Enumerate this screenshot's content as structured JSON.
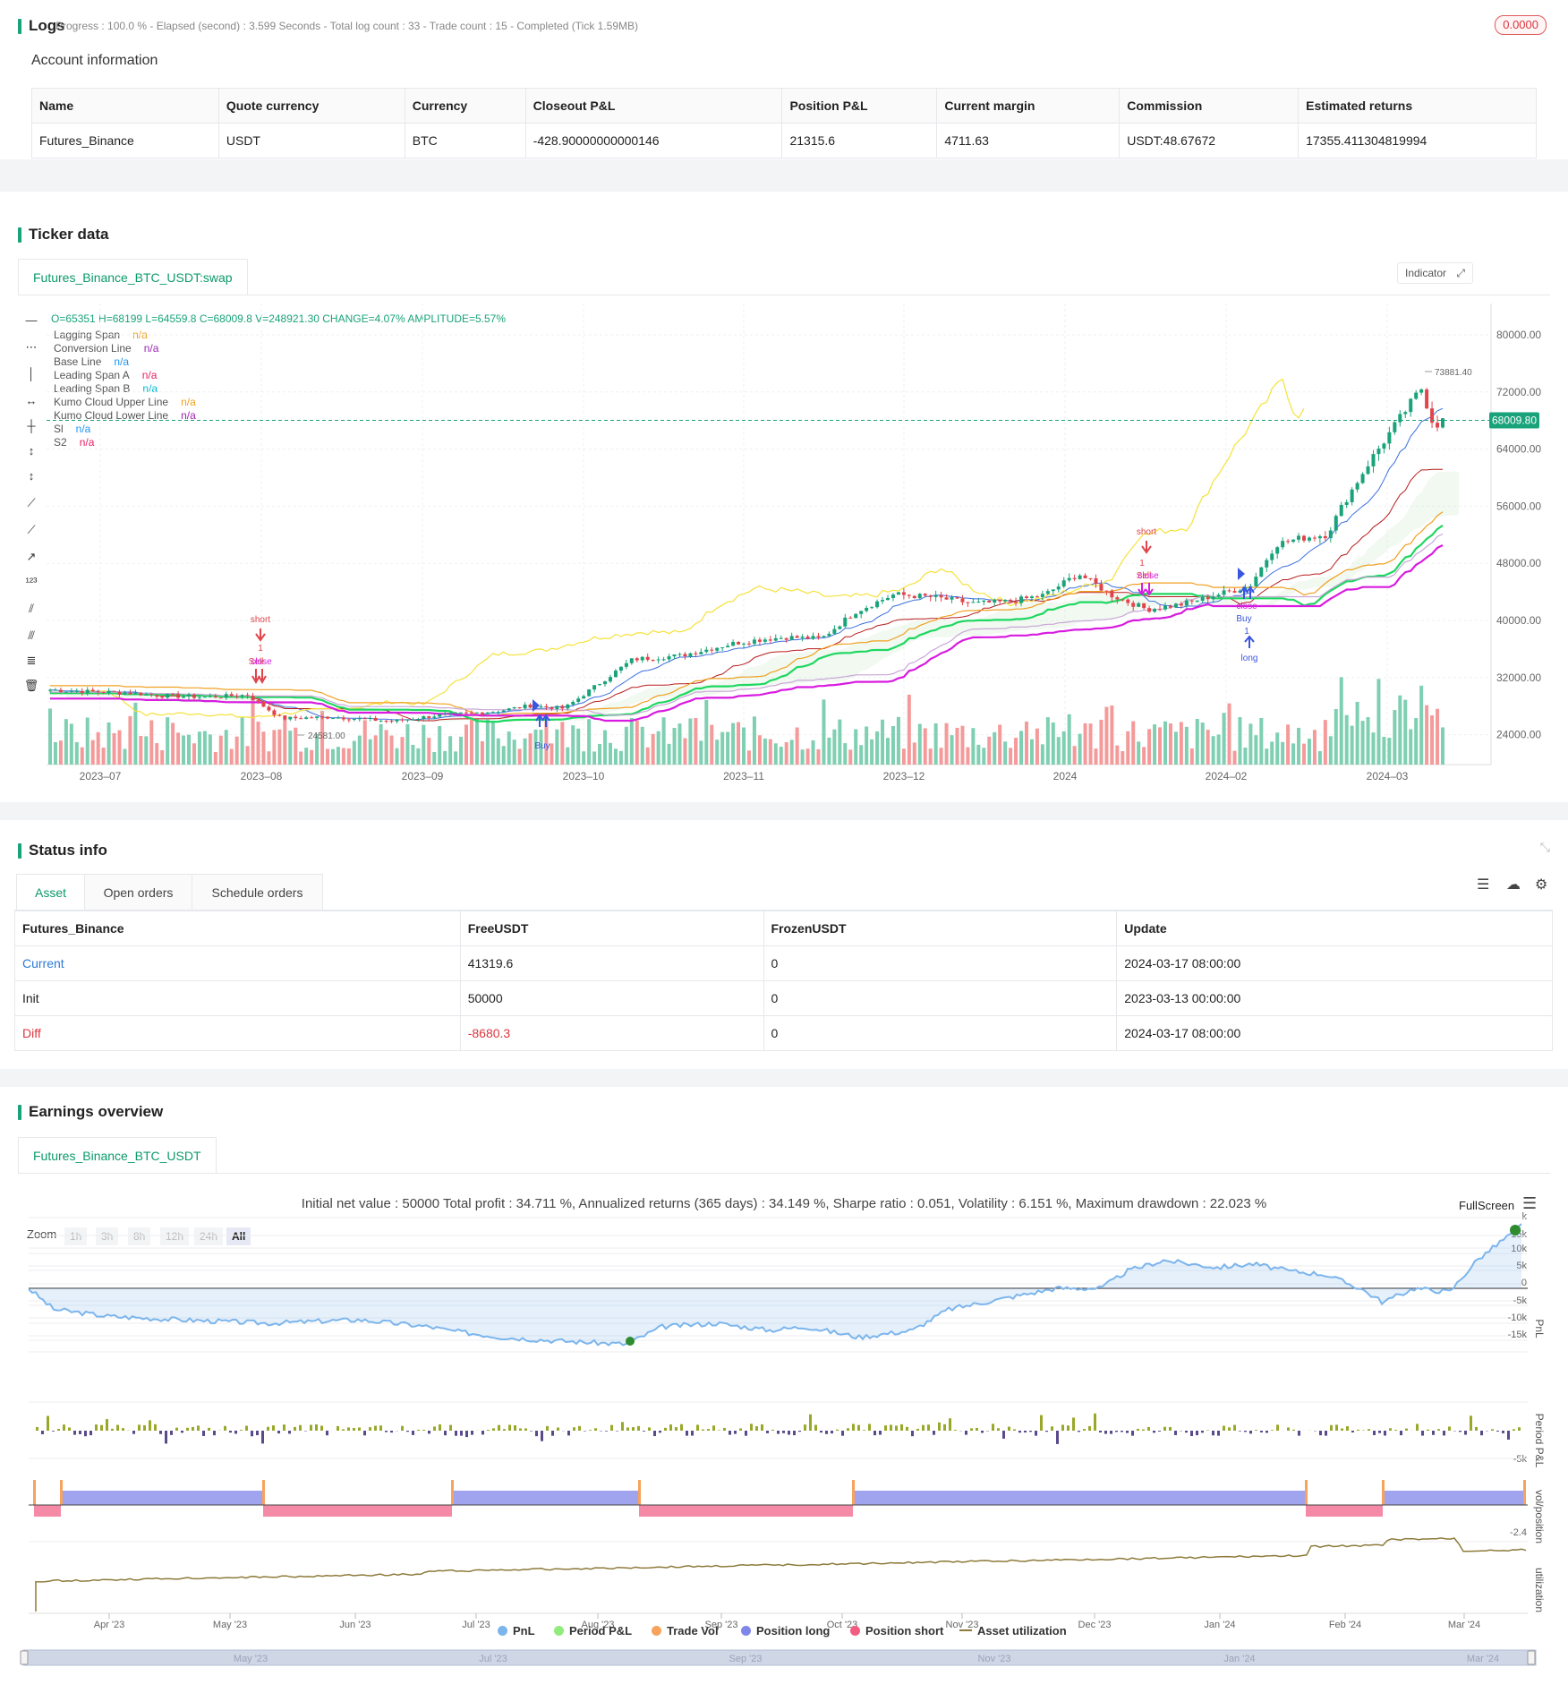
{
  "logs": {
    "title": "Logs",
    "status_line": "Progress : 100.0 % - Elapsed (second) : 3.599  Seconds - Total log count : 33 - Trade count : 15 - Completed (Tick 1.59MB)",
    "badge": "0.0000"
  },
  "account": {
    "title": "Account information",
    "headers": [
      "Name",
      "Quote currency",
      "Currency",
      "Closeout P&L",
      "Position P&L",
      "Current margin",
      "Commission",
      "Estimated returns"
    ],
    "row": [
      "Futures_Binance",
      "USDT",
      "BTC",
      "-428.90000000000146",
      "21315.6",
      "4711.63",
      "USDT:48.67672",
      "17355.411304819994"
    ]
  },
  "ticker": {
    "title": "Ticker data",
    "tab": "Futures_Binance_BTC_USDT:swap",
    "ohlc": "O=65351 H=68199 L=64559.8 C=68009.8 V=248921.30 CHANGE=4.07% AMPLITUDE=5.57%",
    "indicator_btn": "Indicator",
    "legend": [
      {
        "name": "Lagging Span",
        "value": "n/a",
        "color": "#f0a020"
      },
      {
        "name": "Conversion Line",
        "value": "n/a",
        "color": "#9c27b0"
      },
      {
        "name": "Base Line",
        "value": "n/a",
        "color": "#2196f3"
      },
      {
        "name": "Leading Span A",
        "value": "n/a",
        "color": "#e91e63"
      },
      {
        "name": "Leading Span B",
        "value": "n/a",
        "color": "#00bcd4"
      },
      {
        "name": "Kumo Cloud Upper Line",
        "value": "n/a",
        "color": "#f0a020"
      },
      {
        "name": "Kumo Cloud Lower Line",
        "value": "n/a",
        "color": "#9c27b0"
      },
      {
        "name": "Sl",
        "value": "n/a",
        "color": "#2196f3"
      },
      {
        "name": "S2",
        "value": "n/a",
        "color": "#e91e63"
      }
    ],
    "price_label": "68009.80",
    "high_label": "73881.40",
    "low_label": "24581.00",
    "y_ticks": [
      "80000.00",
      "72000.00",
      "64000.00",
      "56000.00",
      "48000.00",
      "40000.00",
      "32000.00",
      "24000.00"
    ],
    "x_ticks": [
      "2023–07",
      "2023–08",
      "2023–09",
      "2023–10",
      "2023–11",
      "2023–12",
      "2024",
      "2024–02",
      "2024–03"
    ],
    "markers": {
      "short1": "short",
      "one1": "1",
      "sell1": "Sell",
      "close1": "close",
      "short2": "short",
      "one2": "1",
      "sell2": "Sell",
      "close2": "close",
      "close3": "close",
      "buy3": "Buy",
      "one3": "1",
      "long3": "long",
      "buy4": "Buy"
    }
  },
  "status": {
    "title": "Status info",
    "tabs": [
      "Asset",
      "Open orders",
      "Schedule orders"
    ],
    "headers": [
      "Futures_Binance",
      "FreeUSDT",
      "FrozenUSDT",
      "Update"
    ],
    "rows": [
      [
        "Current",
        "41319.6",
        "0",
        "2024-03-17 08:00:00"
      ],
      [
        "Init",
        "50000",
        "0",
        "2023-03-13 00:00:00"
      ],
      [
        "Diff",
        "-8680.3",
        "0",
        "2024-03-17 08:00:00"
      ]
    ]
  },
  "earnings": {
    "title": "Earnings overview",
    "tab": "Futures_Binance_BTC_USDT",
    "summary": "Initial net value : 50000 Total profit : 34.711 %, Annualized returns (365 days) : 34.149 %, Sharpe ratio : 0.051, Volatility : 6.151 %, Maximum drawdown : 22.023 %",
    "fullscreen": "FullScreen",
    "zoom_label": "Zoom",
    "zoom_buttons": [
      "1h",
      "3h",
      "8h",
      "12h",
      "24h",
      "All"
    ],
    "pnl_ticks": [
      "15k",
      "10k",
      "5k",
      "0",
      "-5k",
      "-10k",
      "-15k"
    ],
    "pnl_top_tick": "k",
    "period_tick": "-5k",
    "pos_tick": "-2.4",
    "axis_titles": [
      "PnL",
      "Period P&L",
      "vol/position",
      "utilization"
    ],
    "x_ticks": [
      "Apr '23",
      "May '23",
      "Jun '23",
      "Jul '23",
      "Aug '23",
      "Sep '23",
      "Oct '23",
      "Nov '23",
      "Dec '23",
      "Jan '24",
      "Feb '24",
      "Mar '24"
    ],
    "nav_ticks": [
      "May '23",
      "Jul '23",
      "Sep '23",
      "Nov '23",
      "Jan '24",
      "Mar '24"
    ],
    "legend": [
      {
        "name": "PnL",
        "color": "#7cb5ec"
      },
      {
        "name": "Period P&L",
        "color": "#90ed7d"
      },
      {
        "name": "Trade Vol",
        "color": "#f7a35c"
      },
      {
        "name": "Position long",
        "color": "#8085e9"
      },
      {
        "name": "Position short",
        "color": "#f15c80"
      },
      {
        "name": "Asset utilization",
        "color": "#8d7a3a"
      }
    ]
  }
}
